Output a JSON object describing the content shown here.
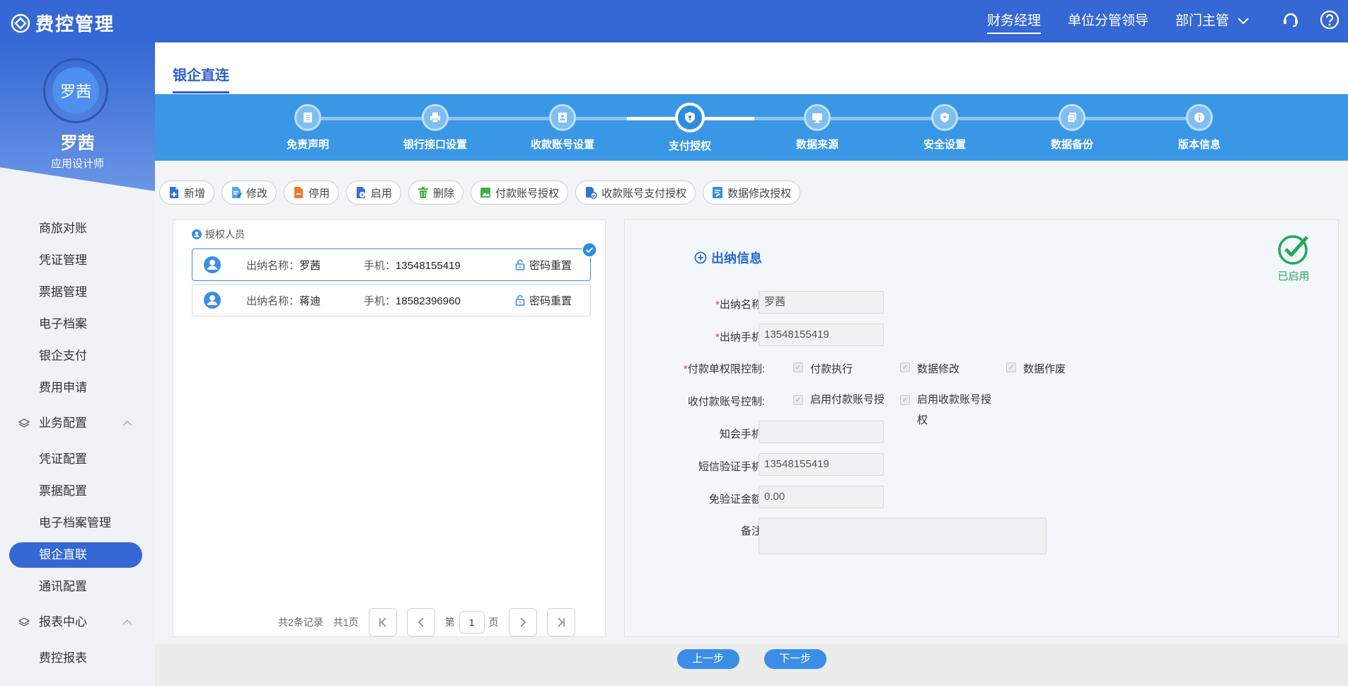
{
  "app": {
    "title": "费控管理"
  },
  "topnav": {
    "items": [
      "财务经理",
      "单位分管领导",
      "部门主管"
    ],
    "active": "财务经理"
  },
  "user": {
    "avatar_text": "罗茜",
    "name": "罗茜",
    "role": "应用设计师"
  },
  "sidebar": {
    "items": [
      "商旅对账",
      "凭证管理",
      "票据管理",
      "电子档案",
      "银企支付",
      "费用申请"
    ],
    "groups": [
      {
        "label": "业务配置",
        "items": [
          "凭证配置",
          "票据配置",
          "电子档案管理",
          "银企直联",
          "通讯配置"
        ]
      },
      {
        "label": "报表中心",
        "items": [
          "费控报表"
        ]
      }
    ],
    "active": "银企直联"
  },
  "page": {
    "tab": "银企直连"
  },
  "steps": {
    "items": [
      "免责声明",
      "银行接口设置",
      "收款账号设置",
      "支付授权",
      "数据来源",
      "安全设置",
      "数据备份",
      "版本信息"
    ],
    "active_index": 3
  },
  "toolbar": {
    "buttons": [
      "新增",
      "修改",
      "停用",
      "启用",
      "删除",
      "付款账号授权",
      "收款账号支付授权",
      "数据修改授权"
    ]
  },
  "auth_list": {
    "title": "授权人员",
    "name_label": "出纳名称：",
    "phone_label": "手机：",
    "reset_label": "密码重置",
    "records": [
      {
        "name": "罗茜",
        "phone": "13548155419",
        "selected": true
      },
      {
        "name": "蒋迪",
        "phone": "18582396960",
        "selected": false
      }
    ]
  },
  "pager": {
    "total": "共2条记录",
    "pages": "共1页",
    "page_prefix": "第",
    "page_value": "1",
    "page_suffix": "页"
  },
  "detail": {
    "title": "出纳信息",
    "status": "已启用",
    "fields": {
      "name_label": "出纳名称:",
      "name_value": "罗茜",
      "phone_label": "出纳手机:",
      "phone_value": "13548155419",
      "pay_ctrl_label": "付款单权限控制:",
      "pay_ctrl_options": [
        "付款执行",
        "数据修改",
        "数据作废"
      ],
      "acct_ctrl_label": "收付款账号控制:",
      "acct_ctrl_options": [
        "启用付款账号授权",
        "启用收款账号授权"
      ],
      "notify_label": "知会手机:",
      "notify_value": "",
      "sms_label": "短信验证手机:",
      "sms_value": "13548155419",
      "exempt_label": "免验证金额:",
      "exempt_value": "0.00",
      "remark_label": "备注:"
    }
  },
  "footer": {
    "prev": "上一步",
    "next": "下一步"
  },
  "colors": {
    "primary": "#3568d4",
    "steps_bg": "#3a97e6",
    "enabled": "#25a85a",
    "required": "#e53935"
  }
}
